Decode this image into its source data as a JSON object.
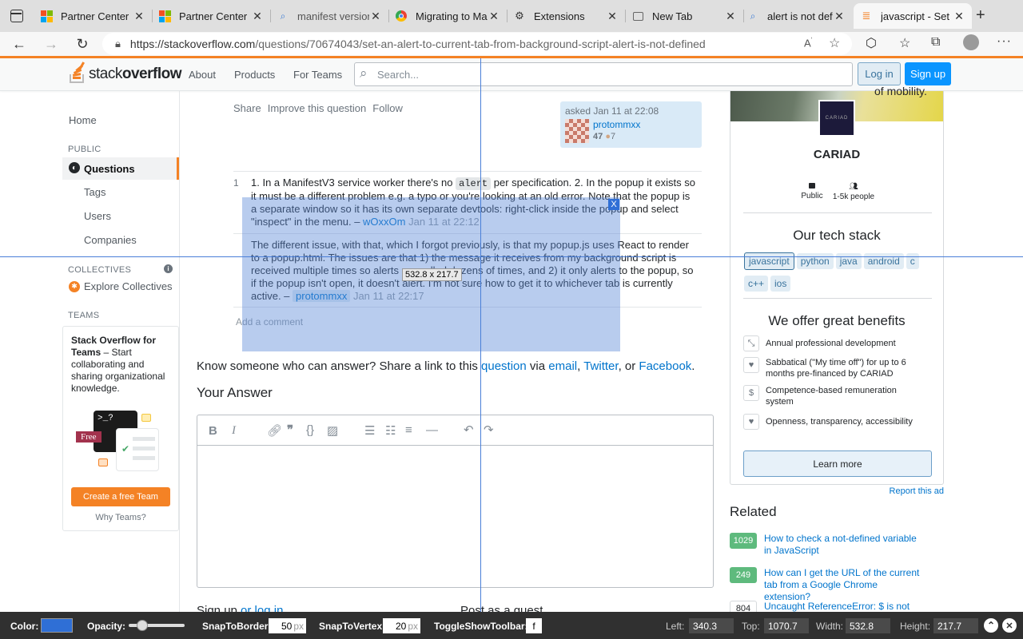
{
  "browser": {
    "tabs": [
      {
        "label": "Partner Center",
        "icon": "microsoft-icon"
      },
      {
        "label": "Partner Center",
        "icon": "microsoft-icon"
      },
      {
        "label": "manifest version",
        "icon": "search-icon"
      },
      {
        "label": "Migrating to Manifest",
        "icon": "chrome-icon"
      },
      {
        "label": "Extensions",
        "icon": "puzzle-icon"
      },
      {
        "label": "New Tab",
        "icon": "newtab-icon"
      },
      {
        "label": "alert is not defined",
        "icon": "search-icon"
      },
      {
        "label": "javascript - Set an alert",
        "icon": "stackoverflow-icon"
      }
    ],
    "url": "https://stackoverflow.com/questions/70674043/set-an-alert-to-current-tab-from-background-script-alert-is-not-defined",
    "url_host": "https://stackoverflow.com",
    "url_path": "/questions/70674043/set-an-alert-to-current-tab-from-background-script-alert-is-not-defined"
  },
  "header": {
    "logo_text_light": "stack",
    "logo_text_bold": "overflow",
    "nav": [
      "About",
      "Products",
      "For Teams"
    ],
    "search_placeholder": "Search...",
    "login": "Log in",
    "signup": "Sign up"
  },
  "sidebar": {
    "home": "Home",
    "public_heading": "PUBLIC",
    "questions": "Questions",
    "tags": "Tags",
    "users": "Users",
    "companies": "Companies",
    "collectives_heading": "COLLECTIVES",
    "explore_collectives": "Explore Collectives",
    "teams_heading": "TEAMS",
    "teams_title": "Stack Overflow for Teams",
    "teams_desc": " – Start collaborating and sharing organizational knowledge.",
    "free_badge": "Free",
    "terminal_text": ">_?",
    "create_team": "Create a free Team",
    "why_teams": "Why Teams?"
  },
  "question": {
    "actions": [
      "Share",
      "Improve this question",
      "Follow"
    ],
    "asked": "asked Jan 11 at 22:08",
    "author": "protommxx",
    "reputation": "47",
    "bronze": "7"
  },
  "comments": [
    {
      "score": "1",
      "part1": "1. In a ManifestV3 service worker there's no ",
      "code": "alert",
      "part2": " per specification. 2. In the popup it exists so it must be a different problem e.g. a typo or you're looking at an old error. Note that the popup is a separate window so it has its own separate devtools: right-click inside the popup and select \"inspect\" in the menu. – ",
      "user": "wOxxOm",
      "date": "Jan 11 at 22:12"
    },
    {
      "score": "",
      "text": "The different issue, with that, which I forgot previously, is that my popup.js uses React to render to a popup.html. The issues are that 1) the message it receives from my background script is received multiple times so alerts are called dozens of times, and 2) it only alerts to the popup, so if the popup isn't open, it doesn't alert. I'm not sure how to get it to whichever tab is currently active. – ",
      "user": "protommxx",
      "date": "Jan 11 at 22:17"
    }
  ],
  "add_comment": "Add a comment",
  "share": {
    "pre": "Know someone who can answer? Share a link to this ",
    "question": "question",
    "via": " via ",
    "email": "email",
    "comma": ", ",
    "twitter": "Twitter",
    "or": ", or ",
    "facebook": "Facebook",
    "dot": "."
  },
  "your_answer": "Your Answer",
  "below": {
    "signup_pre": "Sign up",
    "or_login": "or log in",
    "guest": "Post as a guest"
  },
  "ad": {
    "top_text": "of mobility.",
    "company": "CARIAD",
    "logo_text": "CARIAD",
    "visibility": "Public",
    "size": "1-5k people",
    "tech_heading": "Our tech stack",
    "tech": [
      "javascript",
      "python",
      "java",
      "android",
      "c",
      "c++",
      "ios"
    ],
    "benefits_heading": "We offer great benefits",
    "benefits": [
      "Annual professional development",
      "Sabbatical (\"My time off\") for up to 6 months pre-financed by CARIAD",
      "Competence-based remuneration system",
      "Openness, transparency, accessibility"
    ],
    "learn_more": "Learn more",
    "report": "Report this ad"
  },
  "related": {
    "heading": "Related",
    "items": [
      {
        "score": "1029",
        "title": "How to check a not-defined variable in JavaScript",
        "answered": true
      },
      {
        "score": "249",
        "title": "How can I get the URL of the current tab from a Google Chrome extension?",
        "answered": true
      },
      {
        "score": "804",
        "title": "Uncaught ReferenceError: $ is not",
        "answered": false
      }
    ]
  },
  "overlay": {
    "size_label": "532.8 x 217.7",
    "close": "X",
    "accent": "#2f6fd6"
  },
  "toolbar": {
    "color_label": "Color:",
    "color_value": "#2f6fd6",
    "opacity_label": "Opacity:",
    "opacity": 0.42,
    "snap_border_label": "SnapToBorder:",
    "snap_border": "50",
    "snap_vertex_label": "SnapToVertex:",
    "snap_vertex": "20",
    "unit": "px",
    "toggle_label": "ToggleShowToolbar:",
    "toggle_key": "f",
    "left_label": "Left:",
    "left": "340.3",
    "top_label": "Top:",
    "top": "1070.7",
    "width_label": "Width:",
    "width": "532.8",
    "height_label": "Height:",
    "height": "217.7"
  }
}
